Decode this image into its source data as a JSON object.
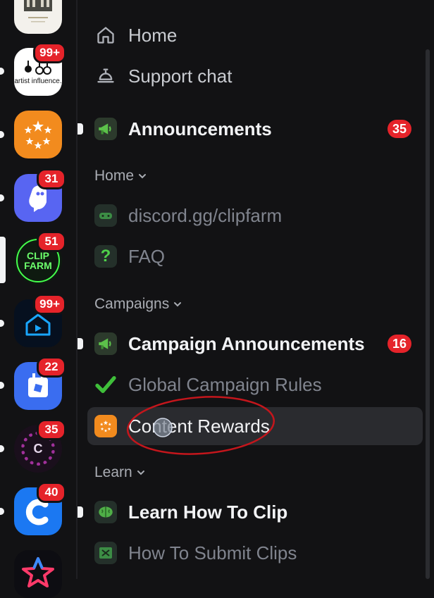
{
  "servers": [
    {
      "name": "server-mansion",
      "badge": ""
    },
    {
      "name": "server-artist-influence",
      "badge": "99+",
      "tile_text": "artist influence."
    },
    {
      "name": "server-stars",
      "badge": ""
    },
    {
      "name": "server-ghost",
      "badge": "31"
    },
    {
      "name": "server-clipfarm",
      "badge": "51",
      "tile_text": "CLIP FARM"
    },
    {
      "name": "server-house",
      "badge": "99+"
    },
    {
      "name": "server-roblox",
      "badge": "22"
    },
    {
      "name": "server-c-purple",
      "badge": "35",
      "tile_text": "C"
    },
    {
      "name": "server-c-blue",
      "badge": "40"
    },
    {
      "name": "server-star-colored",
      "badge": ""
    }
  ],
  "nav": {
    "home_label": "Home",
    "support_label": "Support chat"
  },
  "channels": {
    "announcements": {
      "label": "Announcements",
      "count": "35"
    },
    "cat_home": "Home",
    "discord_link": {
      "label": "discord.gg/clipfarm"
    },
    "faq": {
      "label": "FAQ"
    },
    "cat_campaigns": "Campaigns",
    "campaign_announcements": {
      "label": "Campaign Announcements",
      "count": "16"
    },
    "global_rules": {
      "label": "Global Campaign Rules"
    },
    "content_rewards": {
      "label": "Content Rewards"
    },
    "cat_learn": "Learn",
    "learn_clip": {
      "label": "Learn How To Clip"
    },
    "submit_clips": {
      "label": "How To Submit Clips"
    }
  },
  "colors": {
    "badge_red": "#e5232a",
    "active_row": "#2a2b2f",
    "annotation_red": "#c4161c"
  }
}
